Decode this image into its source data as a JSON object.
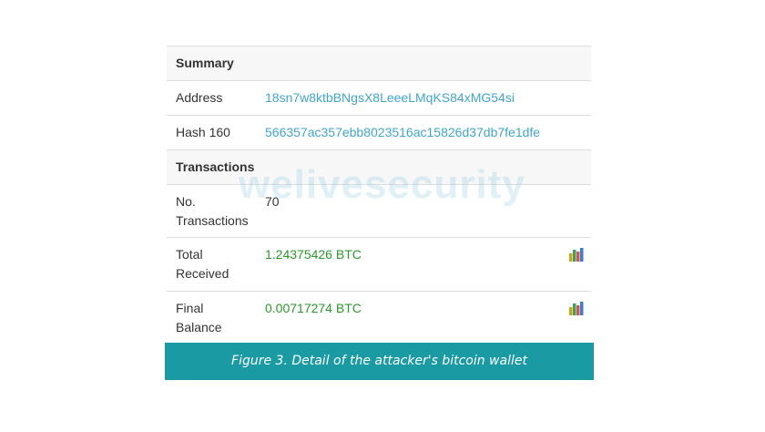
{
  "summary": {
    "heading": "Summary",
    "address_label": "Address",
    "address_value": "18sn7w8ktbBNgsX8LeeeLMqKS84xMG54si",
    "hash160_label": "Hash 160",
    "hash160_value": "566357ac357ebb8023516ac15826d37db7fe1dfe"
  },
  "transactions": {
    "heading": "Transactions",
    "no_transactions_label_line1": "No.",
    "no_transactions_label_line2": "Transactions",
    "no_transactions_value": "70",
    "total_received_label_line1": "Total",
    "total_received_label_line2": "Received",
    "total_received_value": "1.24375426 BTC",
    "final_balance_label_line1": "Final",
    "final_balance_label_line2": "Balance",
    "final_balance_value": "0.00717274 BTC"
  },
  "watermark": "welivesecurity",
  "caption": "Figure 3. Detail of the attacker's bitcoin wallet",
  "colors": {
    "link": "#3fa6cf",
    "btc_value": "#2a9a2a",
    "caption_bg": "#1a9aa3",
    "header_bg": "#f7f7f7"
  },
  "icons": [
    "bar-chart-icon",
    "bar-chart-icon"
  ]
}
